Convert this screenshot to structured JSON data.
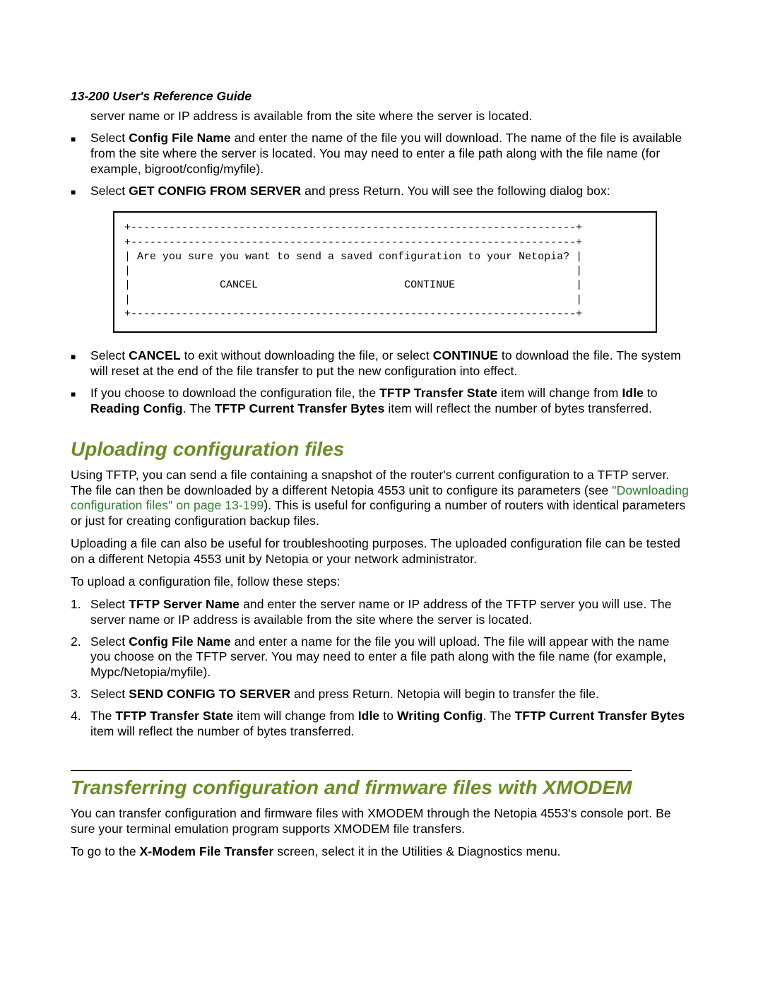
{
  "page_header": "13-200  User's Reference Guide",
  "intro_line": "server name or IP address is available from the site where the server is located.",
  "bullets_top": [
    {
      "pre": "Select ",
      "bold1": "Config File Name",
      "post": " and enter the name of the file you will download. The name of the file is available from the site where the server is located. You may need to enter a file path along with the file name (for example, bigroot/config/myfile)."
    },
    {
      "pre": "Select ",
      "bold1": "GET CONFIG FROM SERVER",
      "post": " and press Return. You will see the following dialog box:"
    }
  ],
  "dialog_ascii": "+----------------------------------------------------------------------+\n+----------------------------------------------------------------------+\n| Are you sure you want to send a saved configuration to your Netopia? |\n|                                                                      |\n|              CANCEL                       CONTINUE                   |\n|                                                                      |\n+----------------------------------------------------------------------+",
  "bullets_mid": [
    {
      "pre": "Select ",
      "bold1": "CANCEL",
      "mid1": " to exit without downloading the file, or select ",
      "bold2": "CONTINUE",
      "post": " to download the file. The system will reset at the end of the file transfer to put the new configuration into effect."
    },
    {
      "pre": "If you choose to download the configuration file, the ",
      "bold1": "TFTP Transfer State",
      "mid1": " item will change from ",
      "bold2": "Idle",
      "mid2": " to ",
      "bold3": "Reading Config",
      "mid3": ". The ",
      "bold4": "TFTP Current Transfer Bytes",
      "post": " item will reflect the number of bytes transferred."
    }
  ],
  "heading_upload": "Uploading configuration files",
  "upload_para1_pre": "Using TFTP, you can send a file containing a snapshot of the router's current configuration to a TFTP server. The file can then be downloaded by a different Netopia 4553 unit to configure its parameters (see ",
  "upload_link_text": "\"Downloading configuration files\" on page 13-199",
  "upload_para1_post": "). This is useful for configuring a number of routers with identical parameters or just for creating configuration backup files.",
  "upload_para2": "Uploading a file can also be useful for troubleshooting purposes. The uploaded configuration file can be tested on a different Netopia 4553 unit by Netopia or your network administrator.",
  "upload_para3": "To upload a configuration file, follow these steps:",
  "num_list": [
    {
      "n": "1.",
      "pre": "Select ",
      "bold1": "TFTP Server Name",
      "post": " and enter the server name or IP address of the TFTP server you will use. The server name or IP address is available from the site where the server is located."
    },
    {
      "n": "2.",
      "pre": "Select ",
      "bold1": "Config File Name",
      "post": " and enter a name for the file you will upload. The file will appear with the name you choose on the TFTP server. You may need to enter a file path along with the file name (for example, Mypc/Netopia/myfile)."
    },
    {
      "n": "3.",
      "pre": "Select ",
      "bold1": "SEND CONFIG TO SERVER",
      "post": " and press Return. Netopia will begin to transfer the file."
    },
    {
      "n": "4.",
      "pre": "The ",
      "bold1": "TFTP Transfer State",
      "mid1": " item will change from ",
      "bold2": "Idle",
      "mid2": " to ",
      "bold3": "Writing Config",
      "mid3": ". The ",
      "bold4": "TFTP Current Transfer Bytes",
      "post": " item will reflect the number of bytes transferred."
    }
  ],
  "heading_xmodem": "Transferring configuration and firmware files with XMODEM",
  "xmodem_para1": "You can transfer configuration and firmware files with XMODEM through the Netopia 4553's console port. Be sure your terminal emulation program supports XMODEM file transfers.",
  "xmodem_para2_pre": "To go to the ",
  "xmodem_para2_bold": "X-Modem File Transfer",
  "xmodem_para2_post": " screen, select it in the Utilities & Diagnostics menu."
}
